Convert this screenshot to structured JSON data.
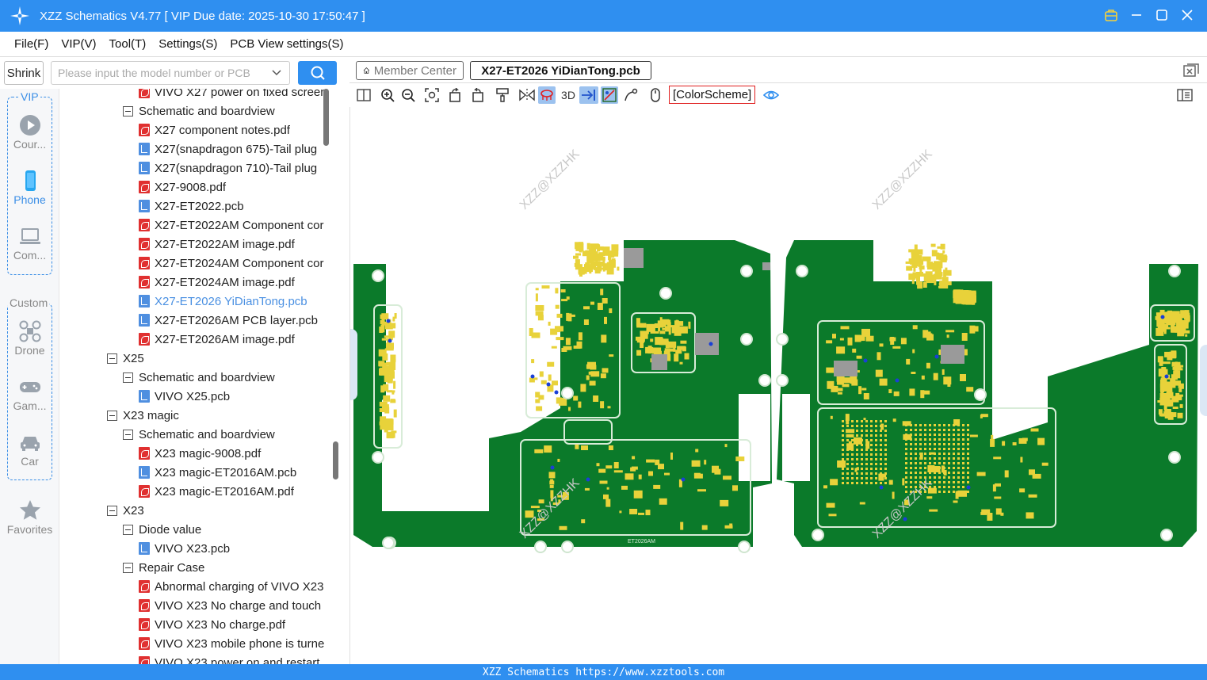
{
  "window": {
    "title": "XZZ Schematics V4.77 [ VIP Due date: 2025-10-30 17:50:47 ]"
  },
  "menu": [
    "File(F)",
    "VIP(V)",
    "Tool(T)",
    "Settings(S)",
    "PCB View settings(S)"
  ],
  "search": {
    "shrink_label": "Shrink",
    "placeholder": "Please input the model number or PCB"
  },
  "rail": {
    "vip_label": "VIP",
    "custom_label": "Custom",
    "items": [
      {
        "label": "Cour...",
        "icon": "play-circle-icon"
      },
      {
        "label": "Phone",
        "icon": "phone-icon"
      },
      {
        "label": "Com...",
        "icon": "laptop-icon"
      },
      {
        "label": "Drone",
        "icon": "drone-icon"
      },
      {
        "label": "Gam...",
        "icon": "gamepad-icon"
      },
      {
        "label": "Car",
        "icon": "car-icon"
      },
      {
        "label": "Favorites",
        "icon": "star-icon"
      }
    ]
  },
  "tree": [
    {
      "label": "VIVO X27 power on fixed screen",
      "type": "pdf",
      "level": 2
    },
    {
      "label": "Schematic and boardview",
      "type": "folder",
      "level": 1
    },
    {
      "label": "X27 component notes.pdf",
      "type": "pdf",
      "level": 2
    },
    {
      "label": "X27(snapdragon 675)-Tail plug",
      "type": "pcb",
      "level": 2
    },
    {
      "label": "X27(snapdragon 710)-Tail plug",
      "type": "pcb",
      "level": 2
    },
    {
      "label": "X27-9008.pdf",
      "type": "pdf",
      "level": 2
    },
    {
      "label": "X27-ET2022.pcb",
      "type": "pcb",
      "level": 2
    },
    {
      "label": "X27-ET2022AM Component cor",
      "type": "pdf",
      "level": 2
    },
    {
      "label": "X27-ET2022AM image.pdf",
      "type": "pdf",
      "level": 2
    },
    {
      "label": "X27-ET2024AM Component cor",
      "type": "pdf",
      "level": 2
    },
    {
      "label": "X27-ET2024AM image.pdf",
      "type": "pdf",
      "level": 2
    },
    {
      "label": "X27-ET2026 YiDianTong.pcb",
      "type": "pcb",
      "level": 2,
      "active": true
    },
    {
      "label": "X27-ET2026AM PCB layer.pcb",
      "type": "pcb",
      "level": 2
    },
    {
      "label": "X27-ET2026AM image.pdf",
      "type": "pdf",
      "level": 2
    },
    {
      "label": "X25",
      "type": "folder",
      "level": 0
    },
    {
      "label": "Schematic and boardview",
      "type": "folder",
      "level": 1
    },
    {
      "label": "VIVO X25.pcb",
      "type": "pcb",
      "level": 2
    },
    {
      "label": "X23 magic",
      "type": "folder",
      "level": 0
    },
    {
      "label": "Schematic and boardview",
      "type": "folder",
      "level": 1
    },
    {
      "label": "X23 magic-9008.pdf",
      "type": "pdf",
      "level": 2
    },
    {
      "label": "X23 magic-ET2016AM.pcb",
      "type": "pcb",
      "level": 2
    },
    {
      "label": "X23 magic-ET2016AM.pdf",
      "type": "pdf",
      "level": 2
    },
    {
      "label": "X23",
      "type": "folder",
      "level": 0
    },
    {
      "label": "Diode value",
      "type": "folder",
      "level": 1
    },
    {
      "label": "VIVO X23.pcb",
      "type": "pcb",
      "level": 2
    },
    {
      "label": "Repair Case",
      "type": "folder",
      "level": 1
    },
    {
      "label": "Abnormal charging of VIVO X23",
      "type": "pdf",
      "level": 2
    },
    {
      "label": "VIVO X23 No charge and touch",
      "type": "pdf",
      "level": 2
    },
    {
      "label": "VIVO X23 No charge.pdf",
      "type": "pdf",
      "level": 2
    },
    {
      "label": "VIVO X23 mobile phone is turne",
      "type": "pdf",
      "level": 2
    },
    {
      "label": "VIVO X23 power on and restart",
      "type": "pdf",
      "level": 2
    }
  ],
  "tabs": {
    "member": "Member Center",
    "active": "X27-ET2026 YiDianTong.pcb"
  },
  "toolbar": {
    "three_d": "3D",
    "color_scheme": "[ColorScheme]"
  },
  "board": {
    "watermark": "XZZ@XZZHK",
    "silk_label": "ET2026AM",
    "colors": {
      "pcb": "#0b7a2a",
      "pad": "#e8d23a",
      "outline": "#d8ecd8",
      "hole": "#ffffff",
      "via": "#1a3fd6"
    }
  },
  "status": {
    "text": "XZZ Schematics https://www.xzztools.com"
  },
  "colors": {
    "accent": "#2f8ff0",
    "link_active": "#4a90e2"
  }
}
